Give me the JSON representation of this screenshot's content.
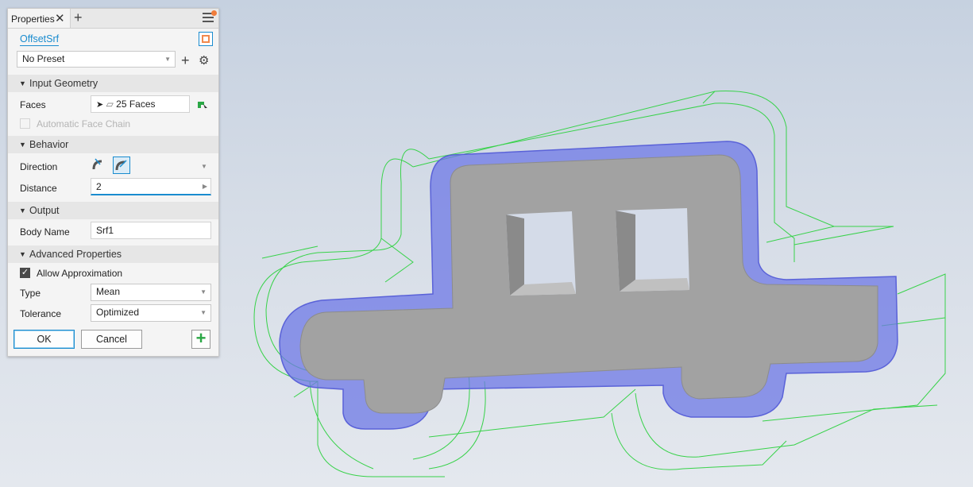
{
  "panel": {
    "tab_label": "Properties",
    "feature_name": "OffsetSrf",
    "preset": "No Preset",
    "sections": {
      "input_geometry": "Input Geometry",
      "behavior": "Behavior",
      "output": "Output",
      "advanced": "Advanced Properties"
    },
    "faces_label": "Faces",
    "faces_value": "25 Faces",
    "auto_chain_label": "Automatic Face Chain",
    "direction_label": "Direction",
    "distance_label": "Distance",
    "distance_value": "2",
    "body_name_label": "Body Name",
    "body_name_value": "Srf1",
    "allow_approx_label": "Allow Approximation",
    "type_label": "Type",
    "type_value": "Mean",
    "tolerance_label": "Tolerance",
    "tolerance_value": "Optimized",
    "ok_label": "OK",
    "cancel_label": "Cancel"
  },
  "colors": {
    "accent": "#1a8ccf",
    "body_fill": "#a2a2a2",
    "offset_face": "#6e78e6",
    "wireframe": "#38d24a",
    "notification": "#f07c3a",
    "apply_plus": "#2aa745"
  }
}
